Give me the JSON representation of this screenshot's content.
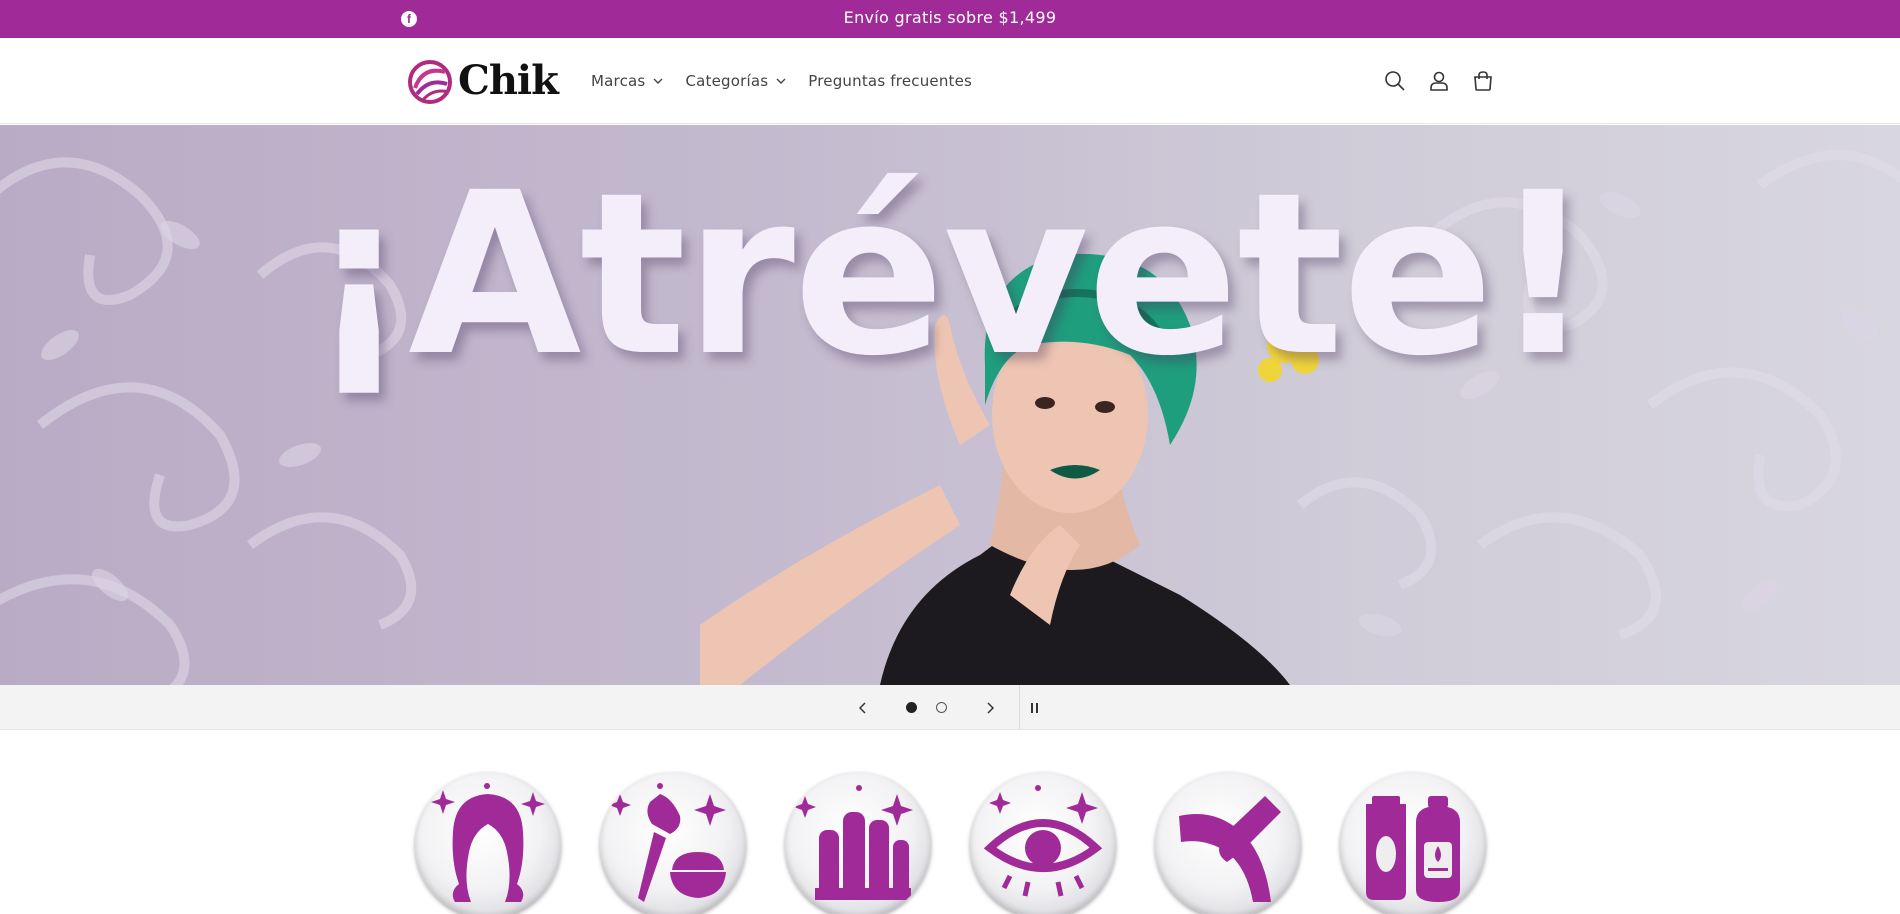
{
  "announcement": {
    "social_icon": "facebook-icon",
    "message": "Envío gratis sobre $1,499"
  },
  "header": {
    "logo_text": "Chik",
    "nav": [
      {
        "label": "Marcas",
        "has_dropdown": true
      },
      {
        "label": "Categorías",
        "has_dropdown": true
      },
      {
        "label": "Preguntas frecuentes",
        "has_dropdown": false
      }
    ],
    "icons": [
      "search-icon",
      "account-icon",
      "cart-icon"
    ]
  },
  "hero": {
    "headline": "¡Atrévete!"
  },
  "slider": {
    "slides_total": 2,
    "active_slide": 1,
    "controls": [
      "previous-icon",
      "next-icon",
      "pause-icon"
    ]
  },
  "categories": [
    {
      "icon": "hair-icon"
    },
    {
      "icon": "makeup-brush-icon"
    },
    {
      "icon": "nails-icon"
    },
    {
      "icon": "eye-icon"
    },
    {
      "icon": "waxing-icon"
    },
    {
      "icon": "skincare-bottles-icon"
    }
  ],
  "colors": {
    "brand": "#a02b98",
    "icon_purple": "#a02b98",
    "header_bg": "#ffffff",
    "controls_bg": "#f3f3f3"
  }
}
